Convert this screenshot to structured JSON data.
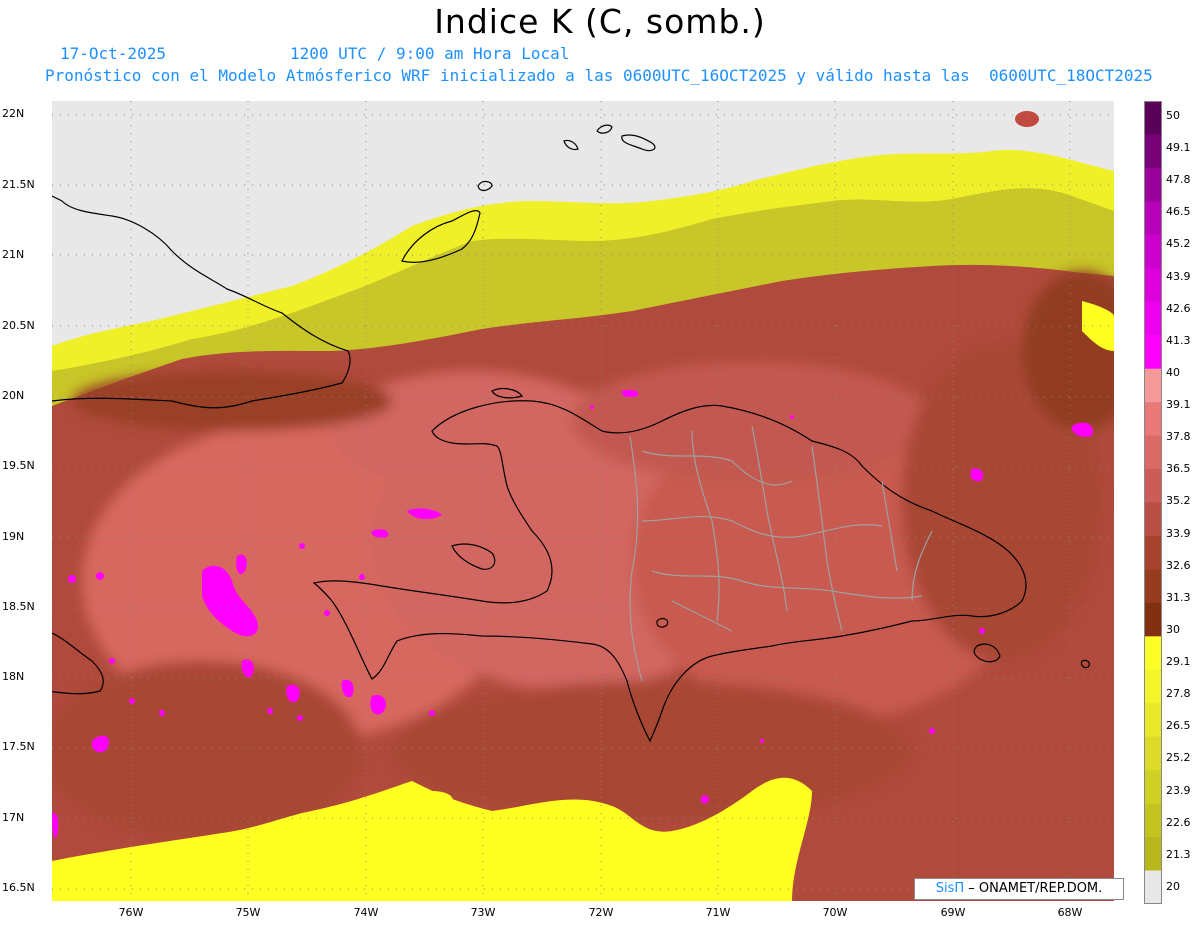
{
  "title": "Indice K (C, somb.)",
  "date": "17-Oct-2025",
  "time": "1200 UTC / 9:00 am Hora Local",
  "run": "Pronóstico con el Modelo Atmósferico WRF inicializado a las 0600UTC_16OCT2025 y válido hasta las  0600UTC_18OCT2025",
  "lat_labels": [
    "22N",
    "21.5N",
    "21N",
    "20.5N",
    "20N",
    "19.5N",
    "19N",
    "18.5N",
    "18N",
    "17.5N",
    "17N",
    "16.5N"
  ],
  "lon_labels": [
    "76W",
    "75W",
    "74W",
    "73W",
    "72W",
    "71W",
    "70W",
    "69W",
    "68W"
  ],
  "legend": {
    "values": [
      "50",
      "49.1",
      "47.8",
      "46.5",
      "45.2",
      "43.9",
      "42.6",
      "41.3",
      "40",
      "39.1",
      "37.8",
      "36.5",
      "35.2",
      "33.9",
      "32.6",
      "31.3",
      "30",
      "29.1",
      "27.8",
      "26.5",
      "25.2",
      "23.9",
      "22.6",
      "21.3",
      "20"
    ],
    "colors": [
      "#5a005a",
      "#7a007a",
      "#9a009a",
      "#b800b8",
      "#cc00cc",
      "#dd00dd",
      "#ee00ee",
      "#ff00ff",
      "#f59a9a",
      "#ea7a7a",
      "#d96a66",
      "#cc5c58",
      "#b84e44",
      "#a8432f",
      "#963c1e",
      "#803010",
      "#ffff28",
      "#f4f42a",
      "#e8e82a",
      "#dcdc28",
      "#d0d024",
      "#c4c420",
      "#b8b81c",
      "#e8e8e8"
    ]
  },
  "credit": {
    "brand": "SisΠ",
    "org": "– ONAMET/REP.DOM."
  },
  "colors": {
    "no_data": "#e8e8e8",
    "yellow": "#ffff22",
    "olive": "#c8c628",
    "dark": "#923c24",
    "mid": "#c45a50",
    "light": "#e07a72",
    "magenta": "#ff00ff",
    "border": "#000000",
    "provinces": "#9a9a9a"
  }
}
